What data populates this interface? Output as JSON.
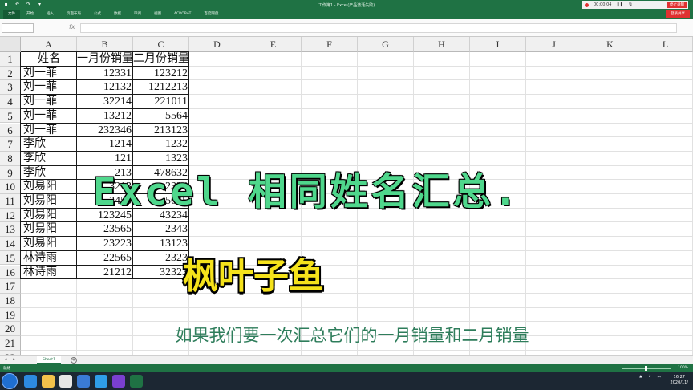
{
  "window": {
    "title": "工作簿1 - Excel(产品激活失败)",
    "recorder_time": "00:00:04",
    "recorder_button": "停止录制"
  },
  "ribbon": {
    "tabs": [
      "文件",
      "开始",
      "插入",
      "页面布局",
      "公式",
      "数据",
      "审阅",
      "视图",
      "ACROBAT",
      "百度网盘"
    ],
    "active_index": 0,
    "share_label": "登录共享"
  },
  "grid": {
    "columns": [
      "A",
      "B",
      "C",
      "D",
      "E",
      "F",
      "G",
      "H",
      "I",
      "J",
      "K",
      "L"
    ],
    "rows": [
      "1",
      "2",
      "3",
      "4",
      "5",
      "6",
      "7",
      "8",
      "9",
      "10",
      "11",
      "12",
      "13",
      "14",
      "15",
      "16",
      "17",
      "18",
      "19",
      "20",
      "21",
      "22"
    ],
    "header": [
      "姓名",
      "一月份销量",
      "二月份销量"
    ],
    "data": [
      [
        "刘一菲",
        "12331",
        "123212"
      ],
      [
        "刘一菲",
        "12132",
        "1212213"
      ],
      [
        "刘一菲",
        "32214",
        "221011"
      ],
      [
        "刘一菲",
        "13212",
        "5564"
      ],
      [
        "刘一菲",
        "232346",
        "213123"
      ],
      [
        "李欣",
        "1214",
        "1232"
      ],
      [
        "李欣",
        "121",
        "1323"
      ],
      [
        "李欣",
        "213",
        "478632"
      ],
      [
        "刘易阳",
        "3213",
        "2324"
      ],
      [
        "刘易阳",
        "3455",
        "5645"
      ],
      [
        "刘易阳",
        "123245",
        "43234"
      ],
      [
        "刘易阳",
        "23565",
        "2343"
      ],
      [
        "刘易阳",
        "23223",
        "13123"
      ],
      [
        "林诗雨",
        "22565",
        "2323"
      ],
      [
        "林诗雨",
        "21212",
        "32323"
      ]
    ]
  },
  "overlay": {
    "title": "Excel 相同姓名汇总.",
    "subtitle": "枫叶子鱼",
    "caption": "如果我们要一次汇总它们的一月销量和二月销量"
  },
  "sheet_tabs": [
    "Sheet1"
  ],
  "status": {
    "ready": "就绪",
    "zoom": "100%"
  },
  "taskbar": {
    "time": "16:27",
    "date": "2020/11/"
  },
  "colors": {
    "excel_green": "#1f7244",
    "title_text": "#4fd78c",
    "subtitle_text": "#f5e21b",
    "caption_text": "#2e7d5b"
  }
}
